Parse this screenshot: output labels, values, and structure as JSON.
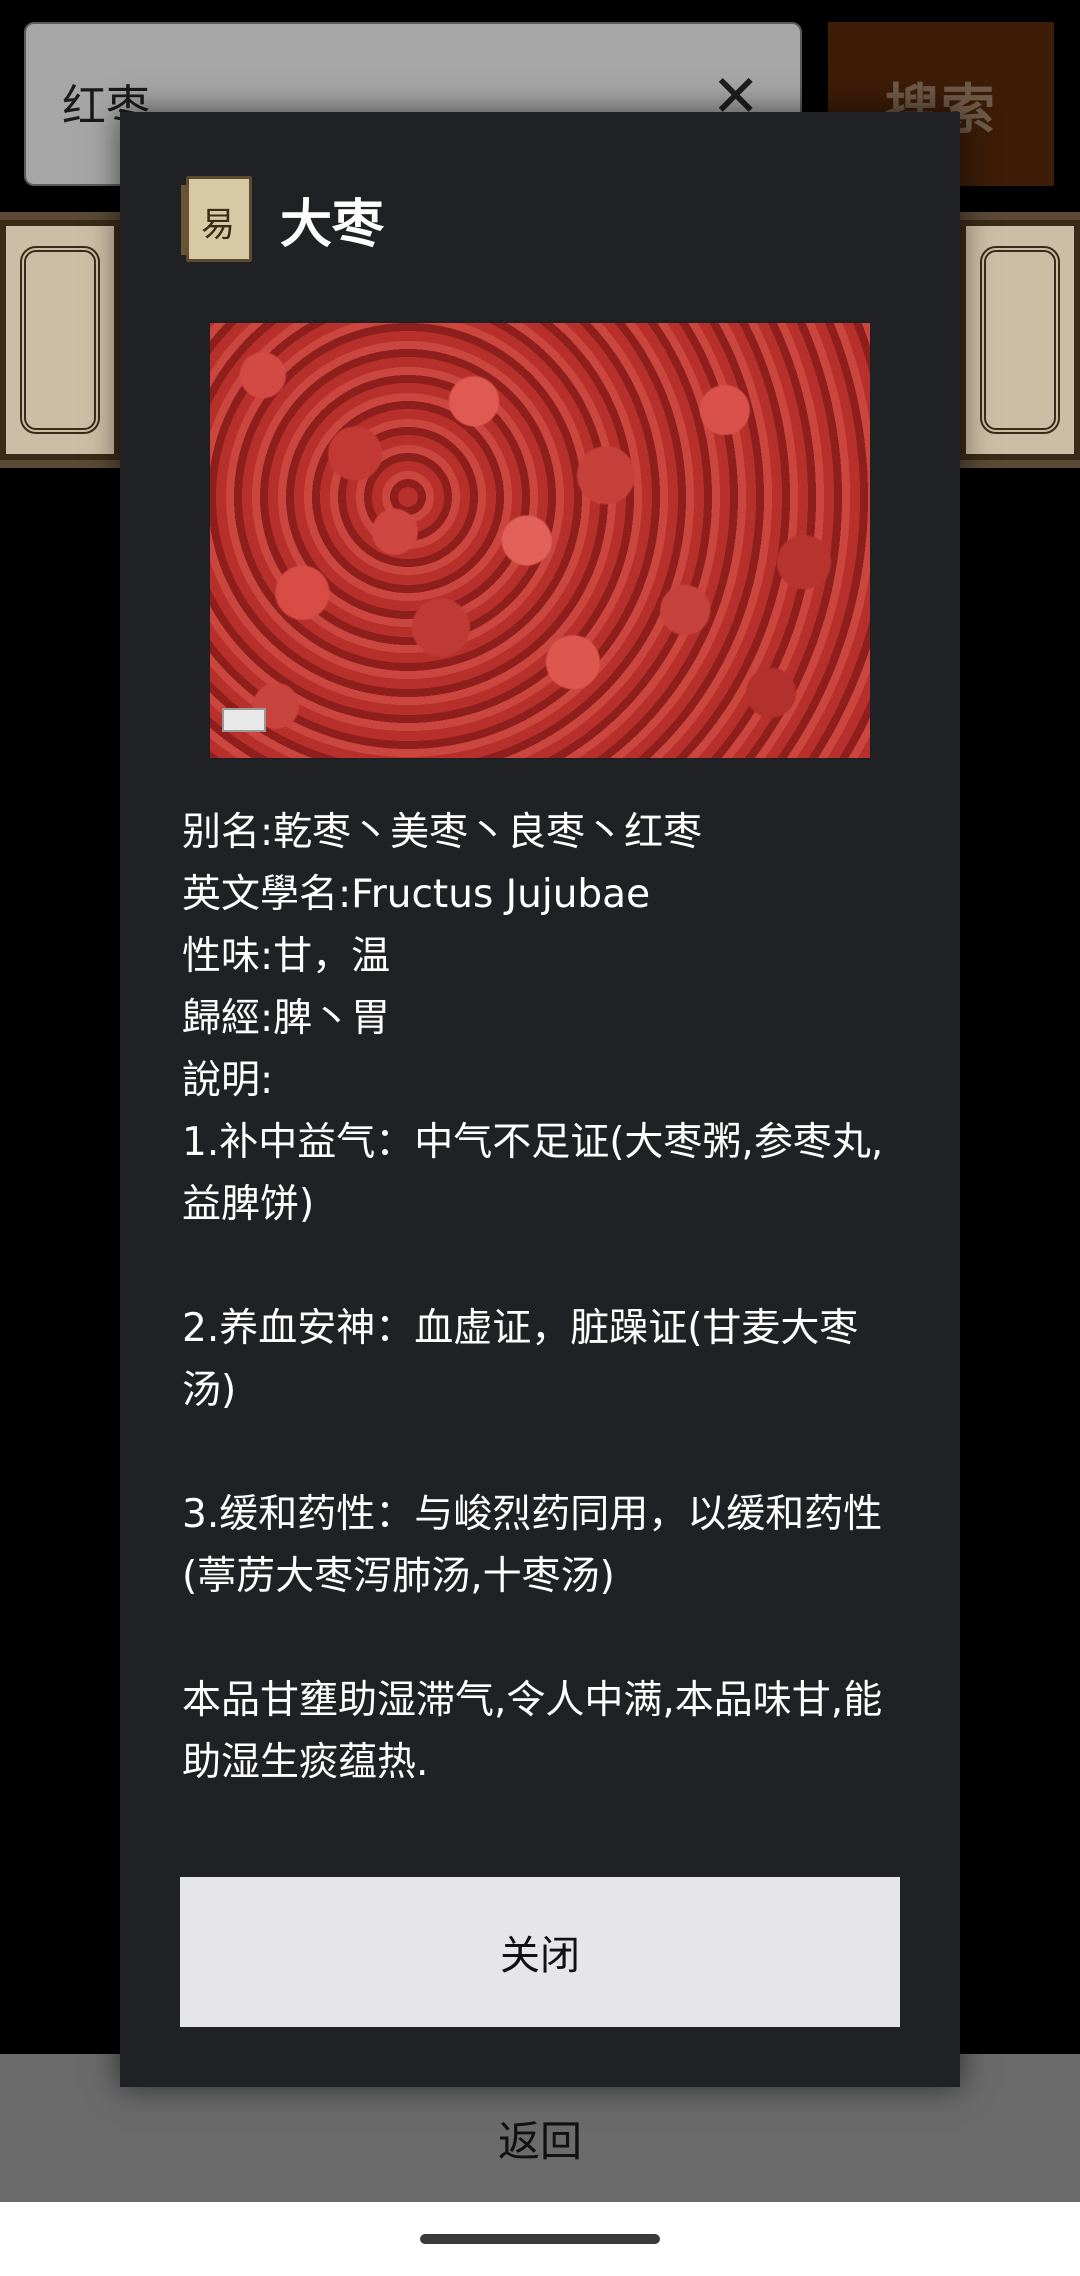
{
  "search": {
    "value": "红枣",
    "clear_icon": "✕",
    "button_label": "搜索"
  },
  "footer": {
    "back_label": "返回"
  },
  "dialog": {
    "title": "大枣",
    "icon": "book-icon",
    "alias": "别名:乾枣丶美枣丶良枣丶红枣",
    "latin_name": "英文學名:Fructus Jujubae",
    "nature_flavor": "性味:甘，温",
    "meridians": "歸經:脾丶胃",
    "description_label": "說明:",
    "items": [
      "1.补中益气：中气不足证(大枣粥,参枣丸,益脾饼)",
      "2.养血安神：血虚证，脏躁证(甘麦大枣汤)",
      "3.缓和药性：与峻烈药同用，以缓和药性(葶苈大枣泻肺汤,十枣汤)",
      "本品甘壅助湿滞气,令人中满,本品味甘,能助湿生痰蕴热."
    ],
    "close_label": "关闭"
  }
}
